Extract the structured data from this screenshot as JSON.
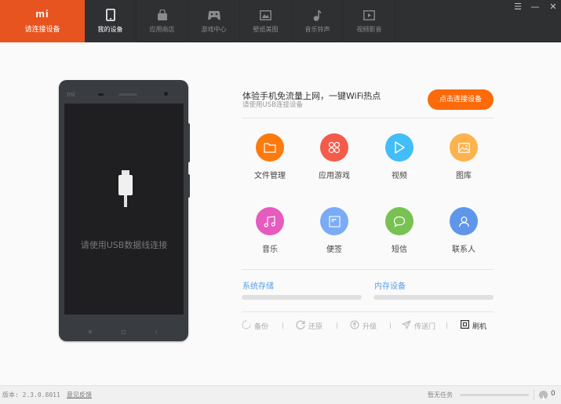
{
  "brand": {
    "logo": "mi",
    "label": "请连接设备",
    "color": "#e8541f"
  },
  "nav": [
    {
      "label": "我的设备",
      "icon": "phone-icon",
      "active": true
    },
    {
      "label": "应用商店",
      "icon": "shopping-bag-icon",
      "active": false
    },
    {
      "label": "游戏中心",
      "icon": "gamepad-icon",
      "active": false
    },
    {
      "label": "壁纸美图",
      "icon": "picture-icon",
      "active": false
    },
    {
      "label": "音乐铃声",
      "icon": "music-note-icon",
      "active": false
    },
    {
      "label": "视频影音",
      "icon": "video-icon",
      "active": false
    }
  ],
  "window_controls": {
    "menu": "☰",
    "minimize": "—",
    "close": "✕"
  },
  "phone": {
    "logo": "mi",
    "hint": "请使用USB数据线连接"
  },
  "promo": {
    "title": "体验手机免流量上网，一键WiFi热点",
    "subtitle": "请使用USB连接设备",
    "button": "点击连接设备",
    "button_color": "#fc6a0a"
  },
  "apps": [
    {
      "label": "文件管理",
      "icon": "folder-icon",
      "color": "#fd7a0f"
    },
    {
      "label": "应用游戏",
      "icon": "apps-grid-icon",
      "color": "#f45b4b"
    },
    {
      "label": "视频",
      "icon": "play-icon",
      "color": "#42bdf8"
    },
    {
      "label": "图库",
      "icon": "gallery-icon",
      "color": "#fdb24d"
    },
    {
      "label": "音乐",
      "icon": "music-icon",
      "color": "#e65bbd"
    },
    {
      "label": "便签",
      "icon": "note-icon",
      "color": "#7aacf6"
    },
    {
      "label": "短信",
      "icon": "message-icon",
      "color": "#78c152"
    },
    {
      "label": "联系人",
      "icon": "contact-icon",
      "color": "#5f96e9"
    }
  ],
  "storage": [
    {
      "label": "系统存储",
      "used_fraction": 0
    },
    {
      "label": "内存设备",
      "used_fraction": 0
    }
  ],
  "tools": [
    {
      "label": "备份",
      "icon": "backup-icon",
      "enabled": false
    },
    {
      "label": "还原",
      "icon": "restore-icon",
      "enabled": false
    },
    {
      "label": "升级",
      "icon": "upgrade-icon",
      "enabled": false
    },
    {
      "label": "传送门",
      "icon": "send-icon",
      "enabled": false
    },
    {
      "label": "刷机",
      "icon": "flash-icon",
      "enabled": true
    }
  ],
  "footer": {
    "version": "版本: 2.3.0.8011",
    "feedback": "意见反馈",
    "task_status": "暂无任务",
    "task_progress": 0,
    "download_count": "0"
  }
}
